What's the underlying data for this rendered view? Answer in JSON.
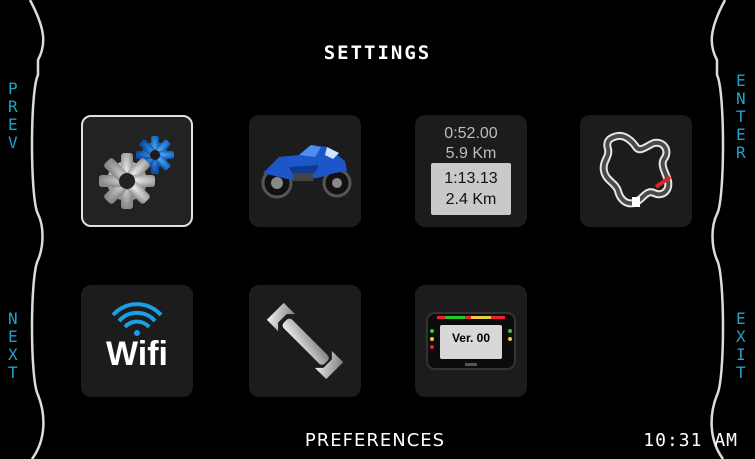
{
  "screen": {
    "title": "SETTINGS",
    "footer_label": "PREFERENCES",
    "clock": "10:31 AM",
    "accent_color": "#1fa3c9"
  },
  "side_buttons": {
    "prev": [
      "P",
      "R",
      "E",
      "V"
    ],
    "next": [
      "N",
      "E",
      "X",
      "T"
    ],
    "enter": [
      "E",
      "N",
      "T",
      "E",
      "R"
    ],
    "exit": [
      "E",
      "X",
      "I",
      "T"
    ]
  },
  "tiles": [
    {
      "id": "general-settings",
      "icon": "gears-icon",
      "selected": true
    },
    {
      "id": "vehicle",
      "icon": "motorcycle-icon",
      "selected": false
    },
    {
      "id": "lap-times",
      "icon": "lap-times-icon",
      "selected": false,
      "lines": {
        "best_time": "0:52.00",
        "best_distance": "5.9 Km",
        "current_time": "1:13.13",
        "current_distance": "2.4 Km"
      }
    },
    {
      "id": "track",
      "icon": "track-map-icon",
      "selected": false
    },
    {
      "id": "wifi",
      "icon": "wifi-icon",
      "selected": false,
      "label": "Wifi"
    },
    {
      "id": "maintenance",
      "icon": "wrench-icon",
      "selected": false
    },
    {
      "id": "firmware",
      "icon": "dashboard-device-icon",
      "selected": false,
      "version_label": "Ver. 00"
    }
  ]
}
